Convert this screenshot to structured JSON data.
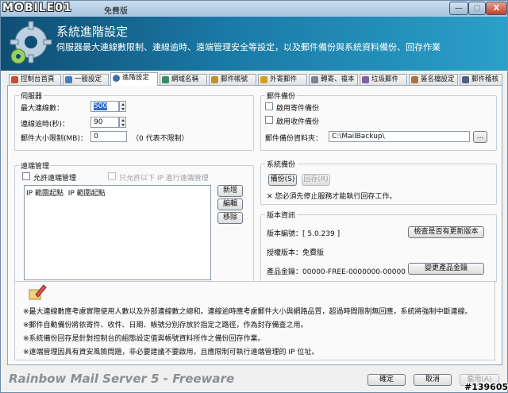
{
  "window": {
    "watermark_logo": "MOBILE01",
    "title": "免費版",
    "minimize_glyph": "—",
    "maximize_glyph": "□",
    "close_glyph": "X"
  },
  "banner": {
    "title": "系統進階設定",
    "description": "伺服器最大連線數限制、連線逾時、遠端管理安全等設定，以及郵件備份與系統資料備份、回存作業",
    "icon": "gear-icon"
  },
  "tabs": [
    {
      "label": "控制台首頁",
      "icon": "home-icon",
      "color": "#c8502c"
    },
    {
      "label": "一般設定",
      "icon": "settings-icon",
      "color": "#4a7cc0"
    },
    {
      "label": "進階設定",
      "icon": "gear-icon",
      "color": "#3a6fae",
      "active": true
    },
    {
      "label": "網域名稱",
      "icon": "globe-icon",
      "color": "#3a8a6a"
    },
    {
      "label": "郵件帳號",
      "icon": "mail-icon",
      "color": "#c09030"
    },
    {
      "label": "外寄郵件",
      "icon": "outbox-icon",
      "color": "#d0a020"
    },
    {
      "label": "轉寄、複本",
      "icon": "forward-icon",
      "color": "#808090"
    },
    {
      "label": "垃圾郵件",
      "icon": "spam-icon",
      "color": "#8060a0"
    },
    {
      "label": "簽名檔設定",
      "icon": "signature-icon",
      "color": "#b07040"
    },
    {
      "label": "郵件稽核",
      "icon": "audit-icon",
      "color": "#506080"
    }
  ],
  "server": {
    "title": "伺服器",
    "max_conn_label": "最大連線數：",
    "max_conn_value": "500",
    "timeout_label": "連線逾時(秒)：",
    "timeout_value": "90",
    "size_label": "郵件大小限制(MB)：",
    "size_value": "0",
    "size_hint": "（0 代表不限制）"
  },
  "mail_backup": {
    "title": "郵件備份",
    "enable_outgoing": "啟用寄件備份",
    "enable_incoming": "啟用收件備份",
    "folder_label": "郵件備份資料夾：",
    "folder_value": "C:\\MailBackup\\",
    "browse_label": "..."
  },
  "remote": {
    "title": "遠端管理",
    "allow_label": "允許遠端管理",
    "only_ip_label": "只允許以下 IP 進行遠端管理",
    "col_start": "IP 範圍起點",
    "col_end": "IP 範圍起點",
    "add_label": "新增",
    "edit_label": "編輯",
    "remove_label": "移除"
  },
  "sys_backup": {
    "title": "系統備份",
    "backup_label": "備份(S)",
    "restore_label": "回存(R)",
    "warning": "您必須先停止服務才能執行回存工作。"
  },
  "version": {
    "title": "版本資訊",
    "build_label": "版本編號：[ 5.0.239 ]",
    "check_update_label": "檢查是否有更新版本",
    "license_label": "授權版本：免費版",
    "product_key_label": "產品金鑰：",
    "product_key_value": "00000-FREE-0000000-00000",
    "change_key_label": "變更產品金鑰"
  },
  "notes": [
    "※最大連線數應考慮實際使用人數以及外部連線數之總和。連線逾時應考慮郵件大小與網路品質，超過時間限制無回應，系統將強制中斷連線。",
    "※郵件自動備份將依寄件、收件、日期、帳號分別存放於指定之路徑，作為封存備查之用。",
    "※系統備份回存是針對控制台的組態設定值與帳號資料所作之備份回存作業。",
    "※遠端管理因具有資安風險問題，非必要建議不要啟用，且應限制可執行遠端管理的 IP 位址。"
  ],
  "footer": {
    "brand": "Rainbow Mail Server 5 - Freeware",
    "ok_label": "確定",
    "cancel_label": "取消",
    "apply_label": "套用(A)",
    "watermark_id": "#139605"
  }
}
